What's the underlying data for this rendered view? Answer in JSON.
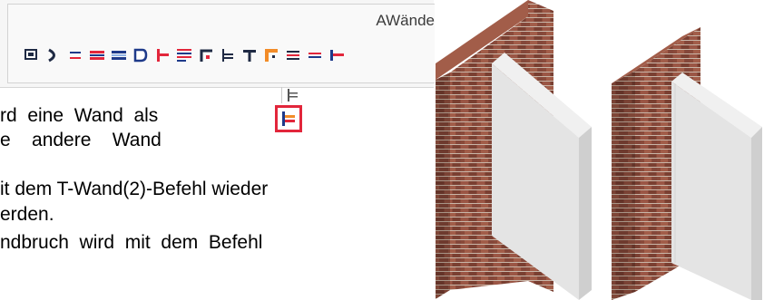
{
  "ribbon": {
    "title": "AWände",
    "tools": [
      "wall-rectangle-icon",
      "wall-arc-icon",
      "wall-single-icon",
      "wall-double-icon",
      "wall-layer-icon",
      "wall-outline-icon",
      "t-wall-icon",
      "wall-list-icon",
      "wall-corner-icon",
      "wall-join-icon",
      "wall-t-join-icon",
      "wall-l-join-icon",
      "wall-split-icon",
      "wall-line-icon",
      "wall-extend-icon"
    ],
    "colors": {
      "accent_red": "#e2263b",
      "accent_blue": "#1e3a8a",
      "accent_orange": "#f28c28"
    }
  },
  "flyout": {
    "items": [
      "t-wall-plain-icon",
      "t-wall-2-icon"
    ],
    "highlighted": "t-wall-2-icon",
    "highlight_color": "#e2263b"
  },
  "text": {
    "line1": "rd  eine  Wand  als",
    "line2": "e    andere    Wand",
    "line3": "it dem T-Wand(2)-Befehl wieder",
    "line4": "erden.",
    "line5": "ndbruch  wird  mit  dem  Befehl"
  },
  "illustration": {
    "panels": [
      "brick-wall-with-t-wall-left",
      "brick-wall-with-t-wall-right"
    ],
    "colors": {
      "brick": "#8a4a3a",
      "concrete": "#e4e4e4",
      "mortar": "#c9b6a8"
    }
  }
}
